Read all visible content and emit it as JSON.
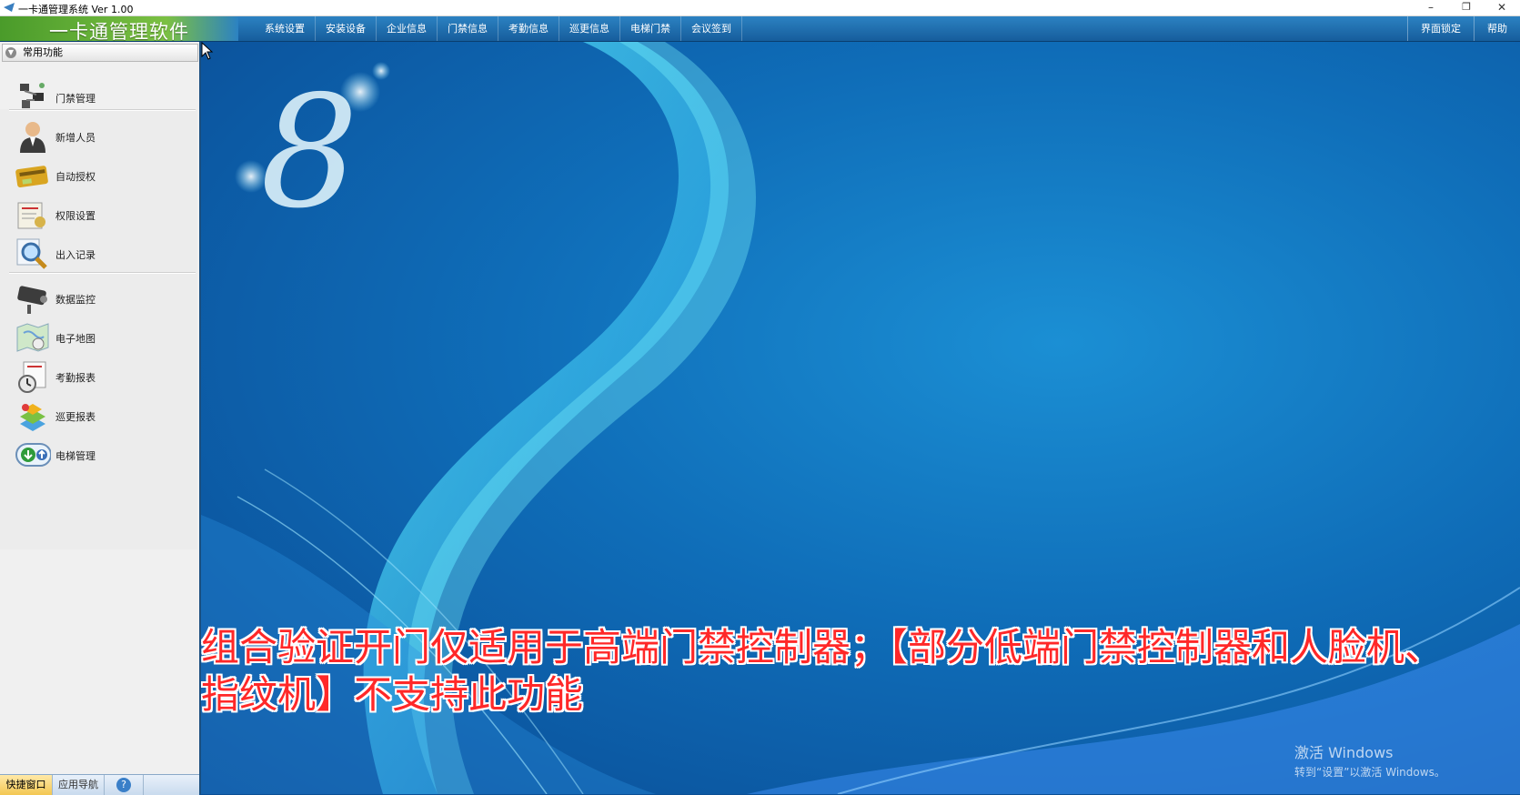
{
  "window": {
    "title": "一卡通管理系统  Ver 1.00",
    "controls": {
      "minimize": "–",
      "restore": "❐",
      "close": "✕"
    }
  },
  "menubar": {
    "brand": "一卡通管理软件",
    "items": [
      "系统设置",
      "安装设备",
      "企业信息",
      "门禁信息",
      "考勤信息",
      "巡更信息",
      "电梯门禁",
      "会议签到"
    ],
    "right_items": [
      "界面锁定",
      "帮助"
    ]
  },
  "sidebar": {
    "header": "常用功能",
    "items": [
      {
        "label": "门禁管理",
        "icon": "access-control-icon"
      },
      {
        "label": "新增人员",
        "icon": "person-icon"
      },
      {
        "label": "自动授权",
        "icon": "card-icon"
      },
      {
        "label": "权限设置",
        "icon": "permission-icon"
      },
      {
        "label": "出入记录",
        "icon": "magnifier-icon"
      },
      {
        "label": "数据监控",
        "icon": "camera-icon"
      },
      {
        "label": "电子地图",
        "icon": "map-icon"
      },
      {
        "label": "考勤报表",
        "icon": "clock-report-icon"
      },
      {
        "label": "巡更报表",
        "icon": "patrol-report-icon"
      },
      {
        "label": "电梯管理",
        "icon": "elevator-icon"
      }
    ],
    "bottom_tabs": [
      "快捷窗口",
      "应用导航",
      "?"
    ]
  },
  "main": {
    "overlay_text": "组合验证开门仅适用于高端门禁控制器；【部分低端门禁控制器和人脸机、\n指纹机】不支持此功能",
    "watermark_line1": "激活 Windows",
    "watermark_line2": "转到“设置”以激活 Windows。"
  },
  "colors": {
    "menubar": "#1f6fb0",
    "brand_green": "#7bc043",
    "background_blue": "#0f6db8",
    "overlay_red": "#ff2828"
  }
}
